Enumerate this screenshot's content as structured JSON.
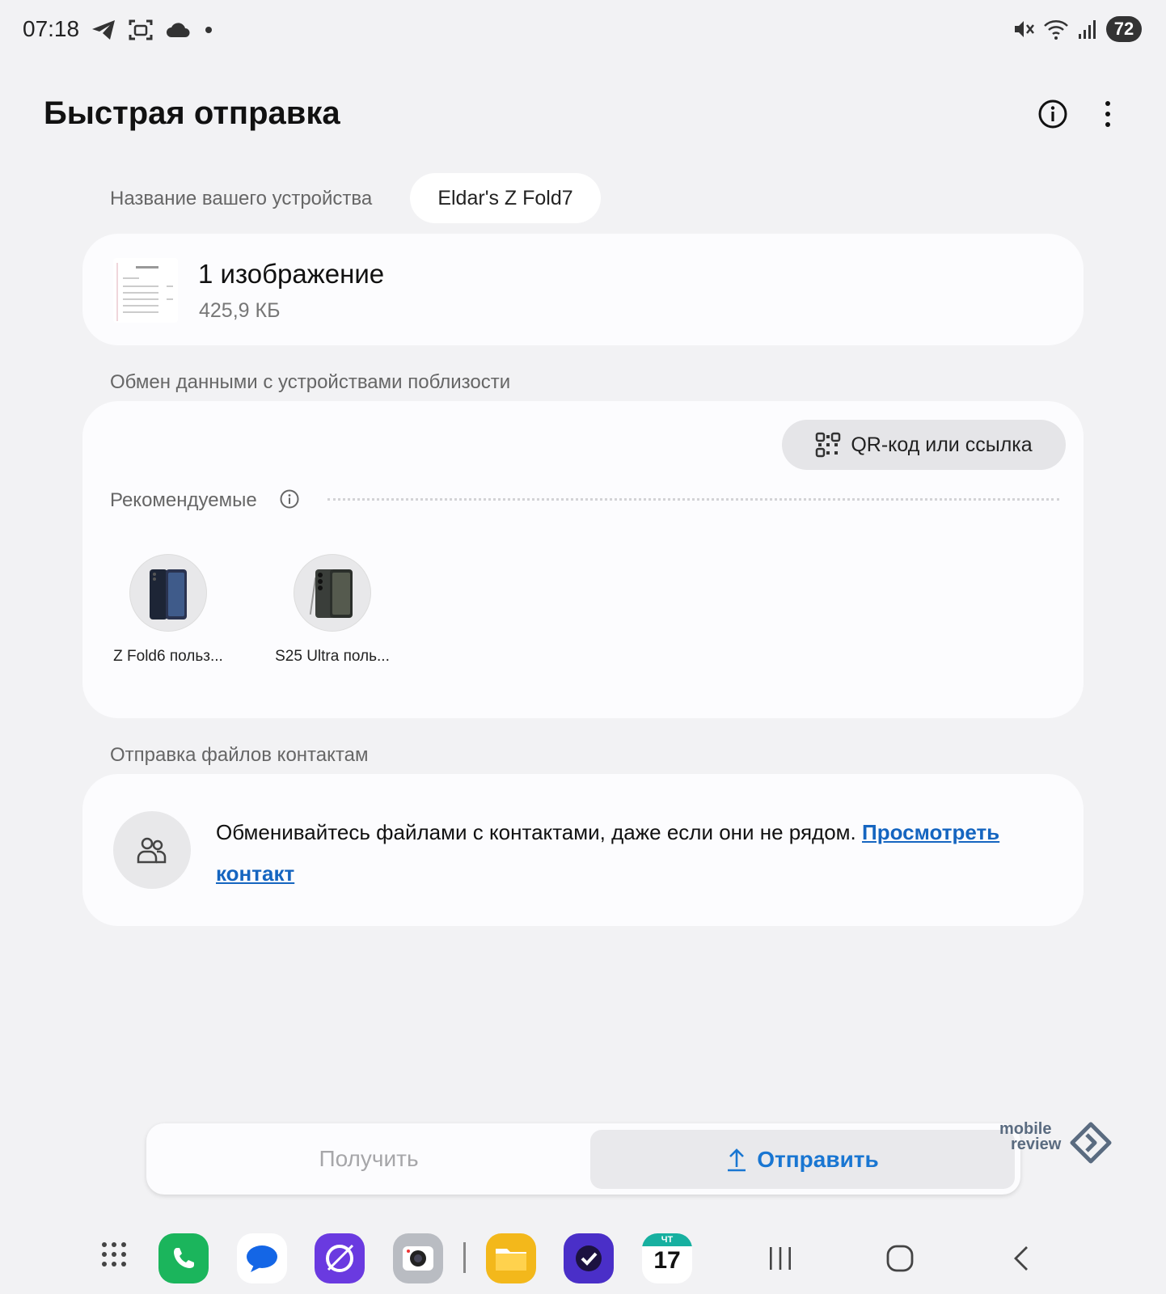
{
  "status_bar": {
    "time": "07:18",
    "battery": "72",
    "left_icons": [
      "telegram-icon",
      "screenshot-icon",
      "cloud-icon",
      "dot-icon"
    ],
    "right_icons": [
      "mute-icon",
      "wifi-icon",
      "signal-icon"
    ]
  },
  "header": {
    "title": "Быстрая отправка"
  },
  "device_name": {
    "label": "Название вашего устройства",
    "value": "Eldar's Z Fold7"
  },
  "file": {
    "title": "1 изображение",
    "size": "425,9 КБ"
  },
  "nearby": {
    "section_title": "Обмен данными с устройствами поблизости",
    "qr_button_label": "QR-код или ссылка",
    "recommended_label": "Рекомендуемые",
    "devices": [
      {
        "label": "Z Fold6 польз..."
      },
      {
        "label": "S25 Ultra поль..."
      }
    ]
  },
  "contacts": {
    "section_title": "Отправка файлов контактам",
    "description": "Обменивайтесь файлами с контактами, даже если они не рядом.",
    "link_line1": "Просмотреть",
    "link_line2": "контакт"
  },
  "tabs": {
    "receive": "Получить",
    "send": "Отправить"
  },
  "watermark": {
    "line1": "mobile",
    "line2": "review"
  },
  "dock": {
    "calendar_day_label": "ЧТ",
    "calendar_date": "17",
    "apps": [
      "apps-grid-icon",
      "phone-icon",
      "messages-icon",
      "browser-icon",
      "camera-icon",
      "files-icon",
      "reminder-icon",
      "calendar-icon"
    ]
  },
  "colors": {
    "background": "#f2f2f4",
    "card": "#fcfcfe",
    "link": "#1565c0",
    "send_accent": "#1976d2"
  }
}
